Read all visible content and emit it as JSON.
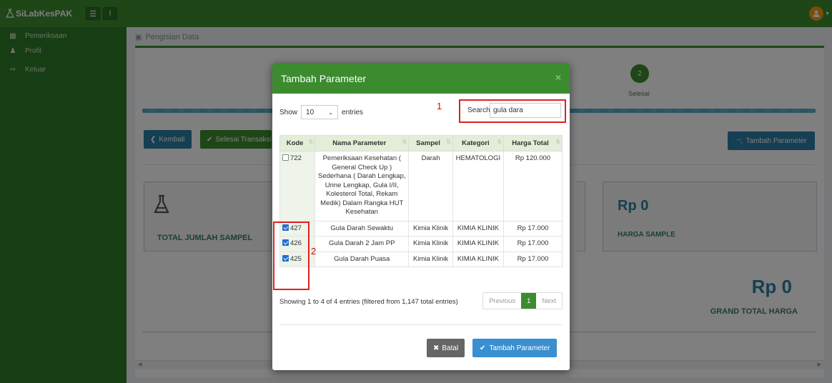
{
  "app": {
    "brand": "SiLabKesPAK"
  },
  "colors": {
    "brand_green": "#3c8c2f",
    "info_blue": "#2a7fa5",
    "annotation_red": "#e02020"
  },
  "sidebar": {
    "items": [
      {
        "label": "Pemeriksaan",
        "icon": "table-icon"
      },
      {
        "label": "Profil",
        "icon": "user-icon"
      },
      {
        "label": "Keluar",
        "icon": "sign-out-icon"
      }
    ]
  },
  "main": {
    "section_title": "Pengisian Data",
    "step": {
      "number": "2",
      "label": "Selesai"
    },
    "buttons": {
      "kembali": "Kembali",
      "selesai": "Selesai Transaksi",
      "tambah": "Tambah Parameter"
    },
    "total_sampel_label": "TOTAL JUMLAH SAMPEL",
    "harga_sample": {
      "value": "Rp  0",
      "label": "HARGA SAMPLE"
    },
    "grand_total": {
      "value": "Rp  0",
      "label": "GRAND TOTAL HARGA"
    }
  },
  "modal": {
    "title": "Tambah Parameter",
    "close": "×",
    "show_label": "Show",
    "entries_value": "10",
    "entries_label": "entries",
    "search_label": "Search:",
    "search_value": "gula dara",
    "annotation_1": "1",
    "annotation_2": "2",
    "columns": [
      "Kode",
      "Nama Parameter",
      "Sampel",
      "Kategori",
      "Harga Total"
    ],
    "rows": [
      {
        "kode": "722",
        "checked": false,
        "nama": "Pemeriksaan Kesehatan ( General Check Up ) Sederhana ( Darah Lengkap, Urine Lengkap, Gula I/II, Kolesterol Total, Rekam Medik) Dalam Rangka HUT Kesehatan",
        "sampel": "Darah",
        "kategori": "HEMATOLOGI",
        "harga": "Rp 120.000"
      },
      {
        "kode": "427",
        "checked": true,
        "nama": "Gula Darah Sewaktu",
        "sampel": "Kimia Klinik",
        "kategori": "KIMIA KLINIK",
        "harga": "Rp 17.000"
      },
      {
        "kode": "426",
        "checked": true,
        "nama": "Gula Darah 2 Jam PP",
        "sampel": "Kimia Klinik",
        "kategori": "KIMIA KLINIK",
        "harga": "Rp 17.000"
      },
      {
        "kode": "425",
        "checked": true,
        "nama": "Gula Darah Puasa",
        "sampel": "Kimia Klinik",
        "kategori": "KIMIA KLINIK",
        "harga": "Rp 17.000"
      }
    ],
    "info": "Showing 1 to 4 of 4 entries (filtered from 1,147 total entries)",
    "pager": {
      "previous": "Previous",
      "current": "1",
      "next": "Next"
    },
    "buttons": {
      "batal": "Batal",
      "tambah": "Tambah Parameter"
    }
  }
}
